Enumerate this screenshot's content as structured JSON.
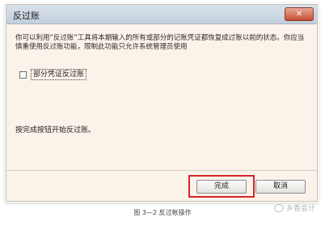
{
  "dialog": {
    "title": "反过账",
    "description": "你可以利用“反过账”工具将本期输入的所有或部分的记账凭证都恢复成过账以前的状态。你应当慎重使用反过账功能，限制此功能只允许系统管理员使用",
    "checkbox_label": "部分凭证反过账",
    "instruction": "按完成按钮开始反过账。",
    "buttons": {
      "complete": "完成",
      "cancel": "取消"
    },
    "close_symbol": "✕"
  },
  "caption": "图 3—2  反过帐操作",
  "watermark": "乡香会计",
  "colors": {
    "highlight": "#d4242b",
    "titlebar": "#c2cfdc",
    "dialog_bg": "#fbf3ea"
  },
  "icons": {
    "close": "close-icon",
    "watermark": "wechat-icon"
  }
}
